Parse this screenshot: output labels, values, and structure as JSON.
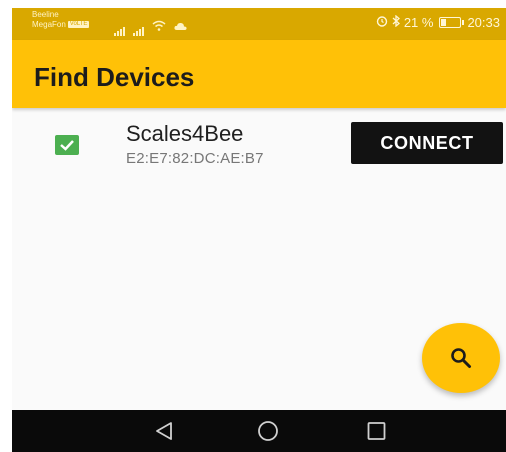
{
  "status_bar": {
    "carrier_1": "Beeline",
    "carrier_2": "MegaFon",
    "carrier_2_tag": "VoLTE",
    "battery_percent": "21 %",
    "time": "20:33",
    "icons": [
      "signal-icon",
      "signal-icon",
      "wifi-icon",
      "cloud-icon",
      "alarm-icon",
      "bluetooth-icon",
      "battery-icon"
    ]
  },
  "app_bar": {
    "title": "Find Devices"
  },
  "devices": [
    {
      "name": "Scales4Bee",
      "mac": "E2:E7:82:DC:AE:B7",
      "checked": true,
      "connect_label": "CONNECT"
    }
  ],
  "fab": {
    "icon": "search-icon"
  },
  "nav_bar": {
    "icons": [
      "back-icon",
      "home-icon",
      "recents-icon"
    ]
  },
  "colors": {
    "status_bar": "#d9a800",
    "app_bar": "#ffc107",
    "checkbox": "#4caf50",
    "connect_button": "#121212",
    "nav_bar": "#0a0a0a"
  }
}
